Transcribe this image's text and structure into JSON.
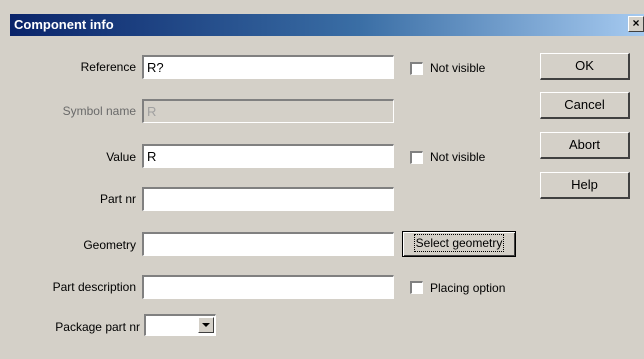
{
  "window": {
    "title": "Component info",
    "close_glyph": "×"
  },
  "fields": {
    "reference": {
      "label": "Reference",
      "value": "R?"
    },
    "symbol_name": {
      "label": "Symbol name",
      "value": "R"
    },
    "value": {
      "label": "Value",
      "value": "R"
    },
    "part_nr": {
      "label": "Part nr",
      "value": ""
    },
    "geometry": {
      "label": "Geometry",
      "value": ""
    },
    "part_description": {
      "label": "Part description",
      "value": ""
    },
    "package_part_nr": {
      "label": "Package part nr",
      "value": ""
    }
  },
  "checkboxes": {
    "reference_not_visible": {
      "label": "Not visible",
      "checked": false
    },
    "value_not_visible": {
      "label": "Not visible",
      "checked": false
    },
    "placing_option": {
      "label": "Placing option",
      "checked": false
    }
  },
  "buttons": {
    "ok": "OK",
    "cancel": "Cancel",
    "abort": "Abort",
    "help": "Help",
    "select_geometry": "Select geometry"
  },
  "colors": {
    "title_start": "#0a246a",
    "title_end": "#a6caf0",
    "dialog_bg": "#d4d0c8"
  }
}
